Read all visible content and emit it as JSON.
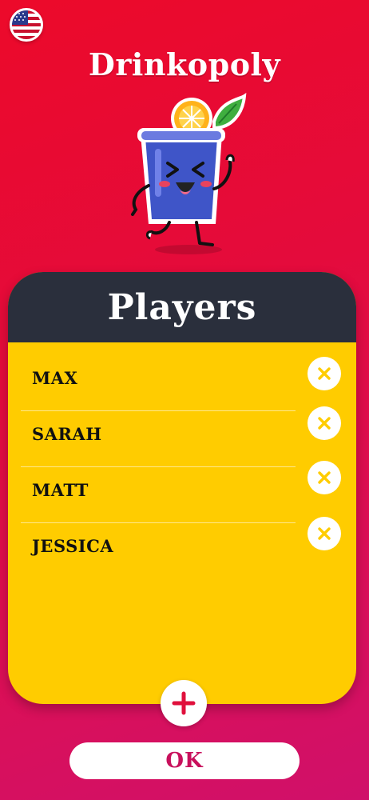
{
  "header": {
    "app_title": "Drinkopoly",
    "language_flag_icon": "us-flag-icon"
  },
  "players_panel": {
    "title": "Players",
    "players": [
      {
        "name": "MAX"
      },
      {
        "name": "SARAH"
      },
      {
        "name": "MATT"
      },
      {
        "name": "JESSICA"
      }
    ],
    "remove_icon": "close-icon",
    "add_icon": "plus-icon"
  },
  "footer": {
    "ok_label": "OK"
  },
  "colors": {
    "background_top": "#ec0a2a",
    "background_bottom": "#d0106a",
    "panel_header": "#2a2f3c",
    "panel_body": "#ffcc00",
    "accent": "#ffcc00",
    "ok_text": "#c8105c",
    "add_plus": "#e0103c"
  }
}
